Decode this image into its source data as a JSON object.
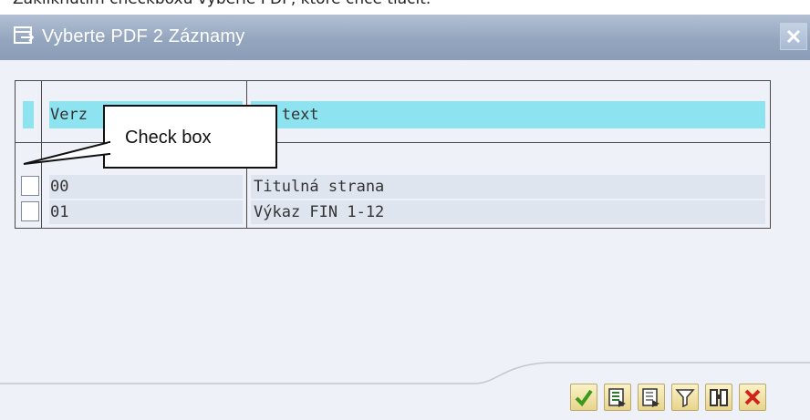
{
  "page_caption": "Zakliknutím checkboxu vyberie PDF, ktoré chce tlačiť.",
  "dialog": {
    "title": "Vyberte PDF 2 Záznamy",
    "icons": {
      "title": "window-icon",
      "close": "close-icon"
    }
  },
  "table": {
    "columns": [
      "Verzia",
      "Dlhý text"
    ],
    "header_visible": {
      "col1": "Verz",
      "col2": "hý text"
    },
    "rows": [
      {
        "selected": false,
        "version": "00",
        "text": "Titulná strana"
      },
      {
        "selected": false,
        "version": "01",
        "text": "Výkaz FIN 1-12"
      }
    ]
  },
  "callout": {
    "text": "Check box"
  },
  "toolbar": {
    "buttons": [
      {
        "name": "confirm",
        "icon": "checkmark-icon"
      },
      {
        "name": "select-all",
        "icon": "select-all-icon"
      },
      {
        "name": "deselect-all",
        "icon": "deselect-all-icon"
      },
      {
        "name": "filter",
        "icon": "filter-icon"
      },
      {
        "name": "find",
        "icon": "binoculars-icon"
      },
      {
        "name": "cancel",
        "icon": "cancel-icon"
      }
    ]
  },
  "colors": {
    "titlebar": "#94a5be",
    "header_highlight": "#8ee3f0",
    "row_background": "#dfe5ee",
    "dialog_background": "#eef1f7"
  }
}
